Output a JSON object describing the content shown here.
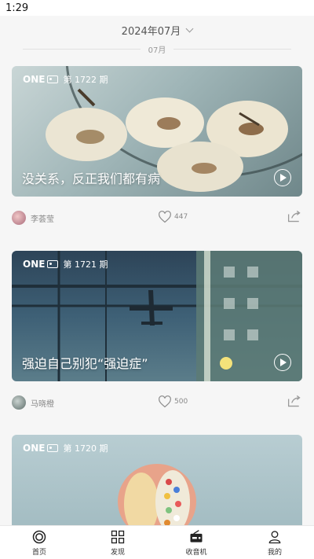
{
  "status": {
    "time": "1:29"
  },
  "header": {
    "month_selector": "2024年07月",
    "section_label": "07月"
  },
  "cards": [
    {
      "issue": "第 1722 期",
      "title": "没关系，反正我们都有病",
      "author": "李荟莹",
      "likes": "447"
    },
    {
      "issue": "第 1721 期",
      "title": "强迫自己别犯“强迫症”",
      "author": "马晓橙",
      "likes": "500"
    },
    {
      "issue": "第 1720 期"
    }
  ],
  "brand": "ONE",
  "tabs": [
    {
      "label": "首页",
      "icon": "home-icon"
    },
    {
      "label": "发现",
      "icon": "grid-icon"
    },
    {
      "label": "收音机",
      "icon": "radio-icon"
    },
    {
      "label": "我的",
      "icon": "user-icon"
    }
  ]
}
